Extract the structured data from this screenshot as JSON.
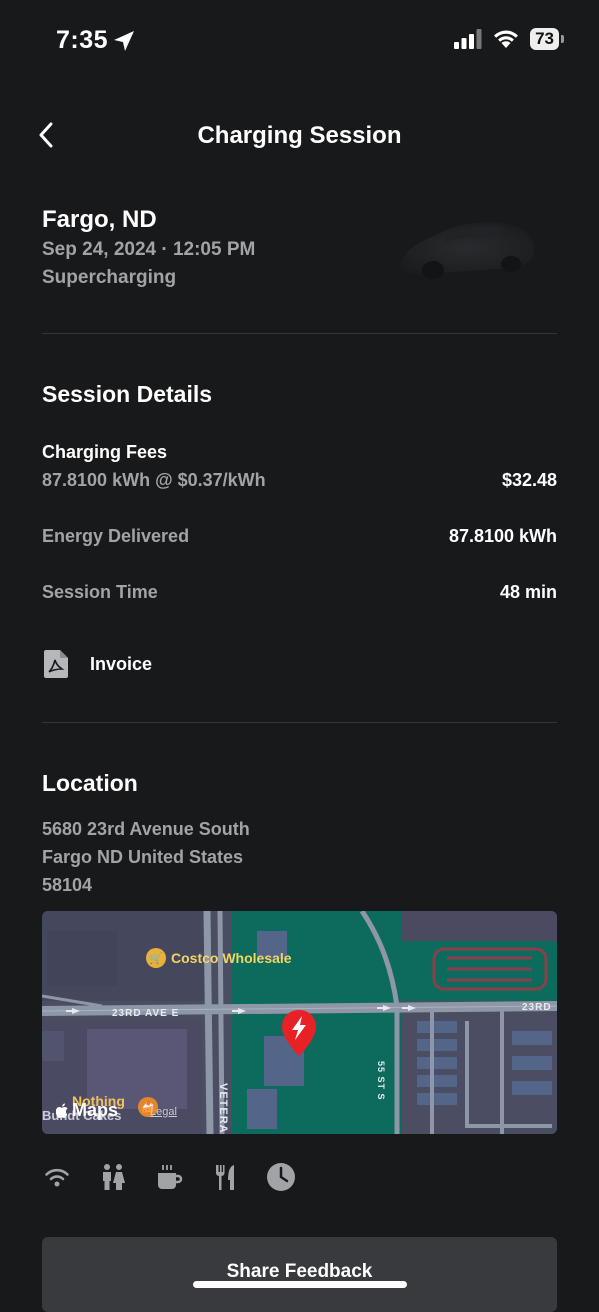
{
  "status_bar": {
    "time": "7:35",
    "battery": "73"
  },
  "header": {
    "title": "Charging Session"
  },
  "session": {
    "city": "Fargo, ND",
    "datetime": "Sep 24, 2024 · 12:05 PM",
    "type": "Supercharging"
  },
  "details": {
    "title": "Session Details",
    "fees_label": "Charging Fees",
    "fees_rate": "87.8100 kWh @ $0.37/kWh",
    "fees_value": "$32.48",
    "energy_label": "Energy Delivered",
    "energy_value": "87.8100 kWh",
    "time_label": "Session Time",
    "time_value": "48 min",
    "invoice_label": "Invoice"
  },
  "location": {
    "title": "Location",
    "address_line1": "5680 23rd Avenue South",
    "address_line2": "Fargo ND United States",
    "address_line3": "58104"
  },
  "map": {
    "poi_costco": "Costco Wholesale",
    "street_23rd_left": "23RD AVE E",
    "street_23rd_right": "23RD",
    "street_55th": "55 ST S",
    "street_veterans": "VETERA",
    "poi_nothing": "Nothing",
    "poi_nothing_sub": "Bundt Cakes",
    "maps_logo": "Maps",
    "legal": "Legal"
  },
  "amenities": [
    "wifi-icon",
    "restroom-icon",
    "coffee-icon",
    "dining-icon",
    "clock-icon"
  ],
  "feedback": {
    "label": "Share Feedback"
  },
  "colors": {
    "background": "#18191b",
    "secondary_text": "#a1a3a7",
    "supercharger_pin": "#e82127",
    "map_green": "#0c6b5c"
  }
}
